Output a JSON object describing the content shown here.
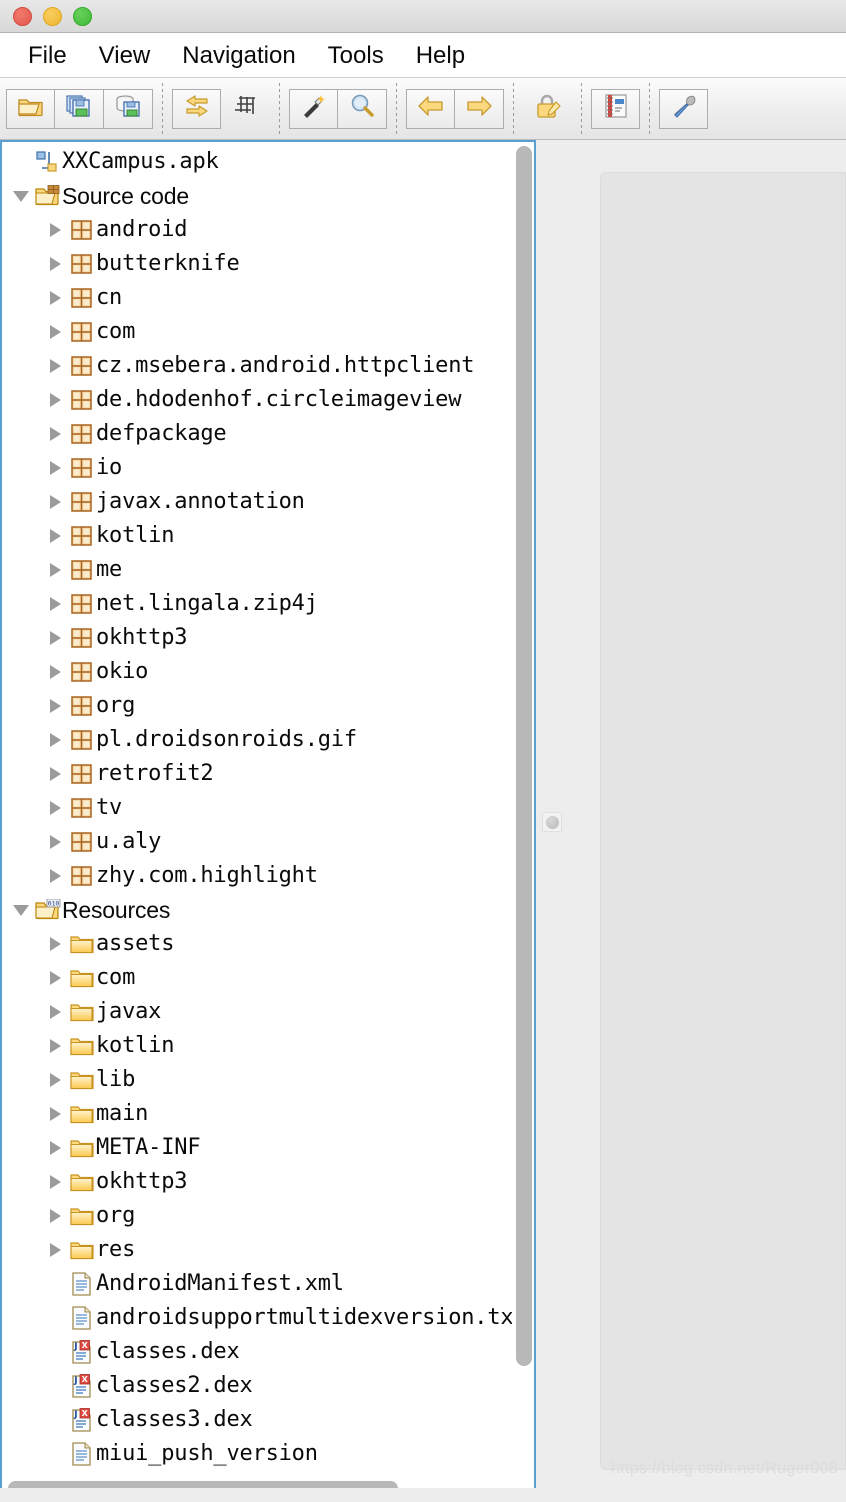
{
  "window": {
    "traffic_lights": [
      "close",
      "minimize",
      "maximize"
    ]
  },
  "menubar": {
    "items": [
      {
        "label": "File",
        "name": "menu-file"
      },
      {
        "label": "View",
        "name": "menu-view"
      },
      {
        "label": "Navigation",
        "name": "menu-navigation"
      },
      {
        "label": "Tools",
        "name": "menu-tools"
      },
      {
        "label": "Help",
        "name": "menu-help"
      }
    ]
  },
  "toolbar": {
    "groups": [
      {
        "buttons": [
          {
            "icon": "open-folder-icon",
            "name": "open-file-button"
          },
          {
            "icon": "save-all-icon",
            "name": "save-all-sources-button"
          },
          {
            "icon": "save-source-icon",
            "name": "save-source-button"
          }
        ]
      },
      {
        "buttons": [
          {
            "icon": "swap-arrows-icon",
            "name": "open-type-button"
          },
          {
            "icon": "grid-icon",
            "name": "open-type-hierarchy-button"
          }
        ]
      },
      {
        "buttons": [
          {
            "icon": "magic-wand-icon",
            "name": "search-wand-button"
          },
          {
            "icon": "magnifier-icon",
            "name": "search-button"
          }
        ]
      },
      {
        "buttons": [
          {
            "icon": "arrow-left-icon",
            "name": "back-button"
          },
          {
            "icon": "arrow-right-icon",
            "name": "forward-button"
          }
        ]
      },
      {
        "buttons": [
          {
            "icon": "lock-edit-icon",
            "name": "preferences-lock-button"
          }
        ]
      },
      {
        "buttons": [
          {
            "icon": "notebook-icon",
            "name": "log-button"
          }
        ]
      },
      {
        "buttons": [
          {
            "icon": "wrench-icon",
            "name": "tools-button"
          }
        ]
      }
    ]
  },
  "tree": {
    "root": {
      "label": "XXCampus.apk",
      "icon": "jar-node-icon",
      "depth": 0,
      "expander": "none"
    },
    "nodes": [
      {
        "label": "Source code",
        "icon": "source-folder-icon",
        "depth": 1,
        "expander": "expanded",
        "font": "sans"
      },
      {
        "label": "android",
        "icon": "package-icon",
        "depth": 2,
        "expander": "collapsed"
      },
      {
        "label": "butterknife",
        "icon": "package-icon",
        "depth": 2,
        "expander": "collapsed"
      },
      {
        "label": "cn",
        "icon": "package-icon",
        "depth": 2,
        "expander": "collapsed"
      },
      {
        "label": "com",
        "icon": "package-icon",
        "depth": 2,
        "expander": "collapsed"
      },
      {
        "label": "cz.msebera.android.httpclient",
        "icon": "package-icon",
        "depth": 2,
        "expander": "collapsed"
      },
      {
        "label": "de.hdodenhof.circleimageview",
        "icon": "package-icon",
        "depth": 2,
        "expander": "collapsed"
      },
      {
        "label": "defpackage",
        "icon": "package-icon",
        "depth": 2,
        "expander": "collapsed"
      },
      {
        "label": "io",
        "icon": "package-icon",
        "depth": 2,
        "expander": "collapsed"
      },
      {
        "label": "javax.annotation",
        "icon": "package-icon",
        "depth": 2,
        "expander": "collapsed"
      },
      {
        "label": "kotlin",
        "icon": "package-icon",
        "depth": 2,
        "expander": "collapsed"
      },
      {
        "label": "me",
        "icon": "package-icon",
        "depth": 2,
        "expander": "collapsed"
      },
      {
        "label": "net.lingala.zip4j",
        "icon": "package-icon",
        "depth": 2,
        "expander": "collapsed"
      },
      {
        "label": "okhttp3",
        "icon": "package-icon",
        "depth": 2,
        "expander": "collapsed"
      },
      {
        "label": "okio",
        "icon": "package-icon",
        "depth": 2,
        "expander": "collapsed"
      },
      {
        "label": "org",
        "icon": "package-icon",
        "depth": 2,
        "expander": "collapsed"
      },
      {
        "label": "pl.droidsonroids.gif",
        "icon": "package-icon",
        "depth": 2,
        "expander": "collapsed"
      },
      {
        "label": "retrofit2",
        "icon": "package-icon",
        "depth": 2,
        "expander": "collapsed"
      },
      {
        "label": "tv",
        "icon": "package-icon",
        "depth": 2,
        "expander": "collapsed"
      },
      {
        "label": "u.aly",
        "icon": "package-icon",
        "depth": 2,
        "expander": "collapsed"
      },
      {
        "label": "zhy.com.highlight",
        "icon": "package-icon",
        "depth": 2,
        "expander": "collapsed"
      },
      {
        "label": "Resources",
        "icon": "resources-folder-icon",
        "depth": 1,
        "expander": "expanded",
        "font": "sans"
      },
      {
        "label": "assets",
        "icon": "folder-icon",
        "depth": 2,
        "expander": "collapsed"
      },
      {
        "label": "com",
        "icon": "folder-icon",
        "depth": 2,
        "expander": "collapsed"
      },
      {
        "label": "javax",
        "icon": "folder-icon",
        "depth": 2,
        "expander": "collapsed"
      },
      {
        "label": "kotlin",
        "icon": "folder-icon",
        "depth": 2,
        "expander": "collapsed"
      },
      {
        "label": "lib",
        "icon": "folder-icon",
        "depth": 2,
        "expander": "collapsed"
      },
      {
        "label": "main",
        "icon": "folder-icon",
        "depth": 2,
        "expander": "collapsed"
      },
      {
        "label": "META-INF",
        "icon": "folder-icon",
        "depth": 2,
        "expander": "collapsed"
      },
      {
        "label": "okhttp3",
        "icon": "folder-icon",
        "depth": 2,
        "expander": "collapsed"
      },
      {
        "label": "org",
        "icon": "folder-icon",
        "depth": 2,
        "expander": "collapsed"
      },
      {
        "label": "res",
        "icon": "folder-icon",
        "depth": 2,
        "expander": "collapsed"
      },
      {
        "label": "AndroidManifest.xml",
        "icon": "xml-file-icon",
        "depth": 2,
        "expander": "none"
      },
      {
        "label": "androidsupportmultidexversion.txt",
        "icon": "text-file-icon",
        "depth": 2,
        "expander": "none"
      },
      {
        "label": "classes.dex",
        "icon": "dex-file-icon",
        "depth": 2,
        "expander": "none"
      },
      {
        "label": "classes2.dex",
        "icon": "dex-file-icon",
        "depth": 2,
        "expander": "none"
      },
      {
        "label": "classes3.dex",
        "icon": "dex-file-icon",
        "depth": 2,
        "expander": "none"
      },
      {
        "label": "miui_push_version",
        "icon": "text-file-icon",
        "depth": 2,
        "expander": "none"
      }
    ],
    "vertical_scrollbar": {
      "thumb_top_pct": 0,
      "thumb_height_pct": 92
    },
    "horizontal_scrollbar": {
      "thumb_left_pct": 0,
      "thumb_width_pct": 75
    }
  },
  "editor": {
    "content": "",
    "placeholder": ""
  },
  "watermark": {
    "text": "https://blog.csdn.net/Ruger008"
  },
  "colors": {
    "accent_border": "#5a9fd4",
    "panel_bg": "#ededed",
    "doc_bg": "#e4e4e4",
    "tree_bg": "#ffffff",
    "scrollbar_thumb": "#b8b8b8",
    "text": "#0a0a0a"
  }
}
